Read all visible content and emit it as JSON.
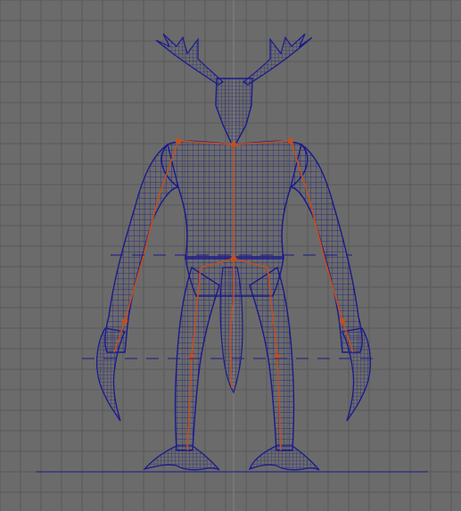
{
  "viewport": {
    "kind": "3d-orthographic-front-view",
    "background_color": "#6b6b6b",
    "grid": {
      "visible": true,
      "line_color": "#5a5a5a",
      "major_color": "#7d7d7d"
    },
    "model": {
      "display_mode": "wireframe",
      "wire_color": "#1a1a8c",
      "wire_fill": "rgba(20,20,110,0.08)",
      "skeleton_visible": true,
      "skeleton_color": "#c05020",
      "ground_line_color": "#1a1a8c"
    }
  }
}
